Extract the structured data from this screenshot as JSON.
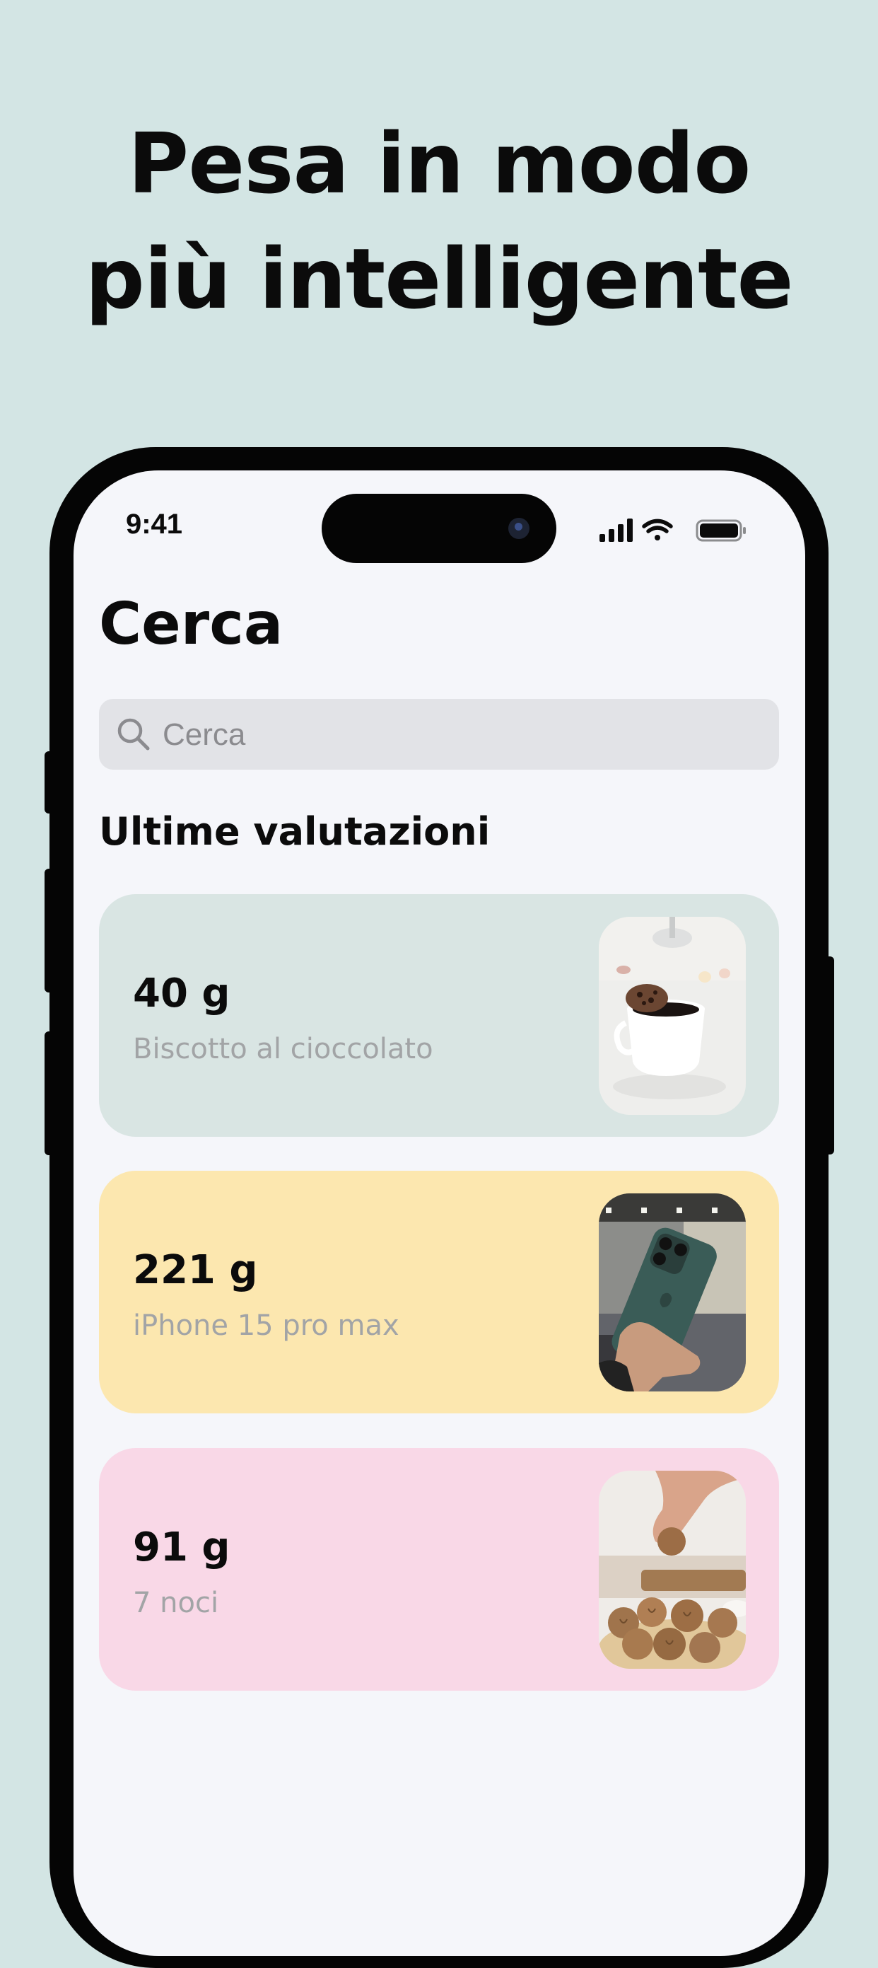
{
  "headline": {
    "line1": "Pesa in modo",
    "line2": "più intelligente"
  },
  "status_bar": {
    "time": "9:41",
    "icons": [
      "cellular-signal-icon",
      "wifi-icon",
      "battery-icon"
    ]
  },
  "screen": {
    "title": "Cerca",
    "search": {
      "placeholder": "Cerca",
      "value": ""
    },
    "section_title": "Ultime valutazioni",
    "cards": [
      {
        "weight": "40 g",
        "description": "Biscotto al cioccolato",
        "image": "coffee-cookie-photo",
        "color": "#d9e5e3"
      },
      {
        "weight": "221 g",
        "description": "iPhone 15 pro max",
        "image": "iphone-photo",
        "color": "#fce7af"
      },
      {
        "weight": "91 g",
        "description": "7 noci",
        "image": "walnuts-photo",
        "color": "#f9d8e7"
      }
    ]
  },
  "colors": {
    "background": "#d3e5e4",
    "screen": "#f5f6fa",
    "search_field": "#e2e3e7",
    "secondary_text": "#a2a4a6"
  }
}
